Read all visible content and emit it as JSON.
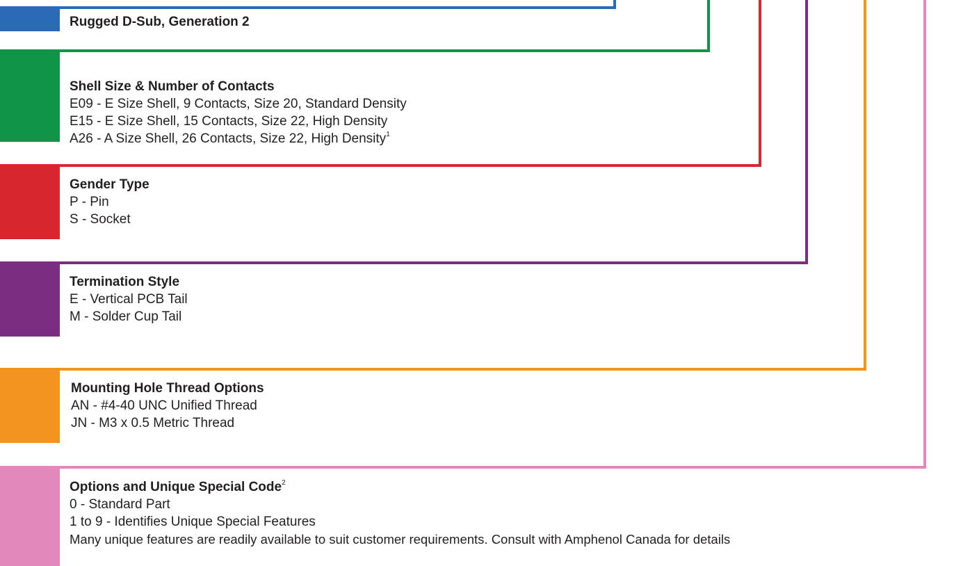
{
  "colors": {
    "blue": "#2b6bb6",
    "green": "#0f9448",
    "red": "#d7262d",
    "purple": "#7b2d81",
    "orange": "#f49420",
    "pink": "#e388ba"
  },
  "sections": [
    {
      "color": "blue",
      "title": "Rugged D-Sub, Generation 2",
      "items": []
    },
    {
      "color": "green",
      "title": "Shell Size & Number of Contacts",
      "items": [
        "E09 - E Size Shell, 9 Contacts, Size 20, Standard Density",
        "E15 - E Size Shell, 15 Contacts, Size 22, High Density",
        "A26 - A Size Shell, 26 Contacts, Size 22, High Density"
      ],
      "item_footnotes": [
        "",
        "",
        "1"
      ]
    },
    {
      "color": "red",
      "title": "Gender Type",
      "items": [
        "P - Pin",
        "S - Socket"
      ]
    },
    {
      "color": "purple",
      "title": "Termination Style",
      "items": [
        "E - Vertical PCB Tail",
        "M - Solder Cup Tail"
      ]
    },
    {
      "color": "orange",
      "title": "Mounting Hole Thread Options",
      "items": [
        "AN - #4-40 UNC Unified Thread",
        "JN - M3 x 0.5 Metric Thread"
      ]
    },
    {
      "color": "pink",
      "title": "Options and Unique Special Code",
      "title_footnote": "2",
      "items": [
        "0 - Standard Part",
        "1 to 9 - Identifies Unique Special Features",
        "Many unique features are readily available to suit customer requirements. Consult with Amphenol Canada for details"
      ]
    }
  ]
}
